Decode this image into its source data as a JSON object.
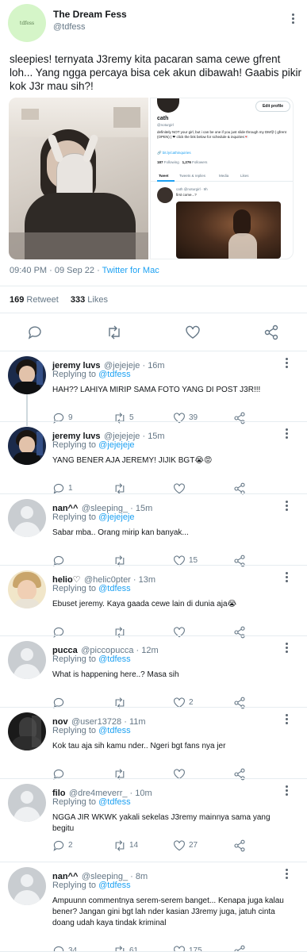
{
  "account": {
    "name": "The Dream Fess",
    "handle": "@tdfess",
    "avatar_text": "tdfess"
  },
  "tweet": {
    "text": "sleepies! ternyata J3remy kita pacaran sama cewe gfrent loh... Yang ngga percaya bisa cek akun dibawah! Gaabis pikir kok J3r mau sih?!",
    "time": "09:40 PM · 09 Sep 22 ·",
    "source": "Twitter for Mac",
    "retweets": "169",
    "retweets_label": "Retweet",
    "likes": "333",
    "likes_label": "Likes"
  },
  "embedded_profile": {
    "edit_button": "Edit profile",
    "name": "cath",
    "handle": "@noturgirl",
    "bio": "definitely NOT your girl, but i can be one if you just slide through my DM😜 | gfrent (OPEN) | ❤ click the link below for schedule & inquiries💌",
    "link": "bit.ly/cathinquiries",
    "following": "187",
    "following_label": "Following",
    "followers": "1,276",
    "followers_label": "Followers",
    "tabs": [
      "Tweet",
      "Tweets & replies",
      "Media",
      "Likes"
    ],
    "post_meta": "cath @noturgirl · 9h",
    "post_text": "first come...?"
  },
  "replies": [
    {
      "name": "jeremy luvs",
      "handle": "@jejejeje",
      "time": "· 16m",
      "replying_prefix": "Replying to",
      "replying_to": "@tdfess",
      "text": "HAH?? LAHIYA MIRIP SAMA FOTO YANG DI POST J3R!!!",
      "comments": "9",
      "retweets": "5",
      "likes": "39",
      "avatar": "jeremy"
    },
    {
      "name": "jeremy luvs",
      "handle": "@jejejeje",
      "time": "· 15m",
      "replying_prefix": "Replying to",
      "replying_to": "@jejejeje",
      "text": "YANG BENER AJA JEREMY! JIJIK BGT😭😡",
      "comments": "1",
      "retweets": "",
      "likes": "",
      "avatar": "jeremy"
    },
    {
      "name": "nan^^",
      "handle": "@sleeping_",
      "time": "· 15m",
      "replying_prefix": "Replying to",
      "replying_to": "@jejejeje",
      "text": "Sabar mba.. Orang mirip kan banyak...",
      "comments": "",
      "retweets": "",
      "likes": "15",
      "avatar": "grey"
    },
    {
      "name": "helio♡",
      "handle": "@helic0pter",
      "time": "· 13m",
      "replying_prefix": "Replying to",
      "replying_to": "@tdfess",
      "text": "Ebuset jeremy. Kaya gaada cewe lain di dunia aja😭",
      "comments": "",
      "retweets": "",
      "likes": "",
      "avatar": "helio"
    },
    {
      "name": "pucca",
      "handle": "@piccopucca",
      "time": "· 12m",
      "replying_prefix": "Replying to",
      "replying_to": "@tdfess",
      "text": "What is happening here..? Masa sih",
      "comments": "",
      "retweets": "",
      "likes": "2",
      "avatar": "grey"
    },
    {
      "name": "nov",
      "handle": "@user13728",
      "time": "· 11m",
      "replying_prefix": "Replying to",
      "replying_to": "@tdfess",
      "text": "Kok tau aja sih kamu nder.. Ngeri bgt fans nya jer",
      "comments": "",
      "retweets": "",
      "likes": "",
      "avatar": "nov"
    },
    {
      "name": "filo",
      "handle": "@dre4meverr_",
      "time": "· 10m",
      "replying_prefix": "Replying to",
      "replying_to": "@tdfess",
      "text": "NGGA JIR WKWK yakali sekelas J3remy mainnya sama yang begitu",
      "comments": "2",
      "retweets": "14",
      "likes": "27",
      "avatar": "grey"
    },
    {
      "name": "nan^^",
      "handle": "@sleeping_",
      "time": "· 8m",
      "replying_prefix": "Replying to",
      "replying_to": "@tdfess",
      "text": "Ampuunn commentnya serem-serem banget... Kenapa juga kalau bener? Jangan gini bgt lah nder kasian J3remy juga, jatuh cinta doang udah kaya tindak kriminal",
      "comments": "34",
      "retweets": "61",
      "likes": "175",
      "avatar": "grey"
    }
  ],
  "colors": {
    "accent": "#1da1f2",
    "muted": "#657786",
    "avatar_green": "#d5f5c8"
  }
}
